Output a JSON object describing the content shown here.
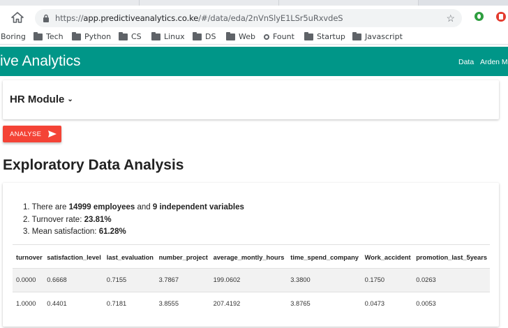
{
  "browser": {
    "url_host": "app.predictiveanalytics.co.ke",
    "url_path": "/#/data/eda/2nVnSlyE1LSr5uRxvdeS",
    "bookmarks": [
      "Boring",
      "Tech",
      "Python",
      "CS",
      "Linux",
      "DS",
      "Web",
      "Fount",
      "Startup",
      "Javascript"
    ]
  },
  "app": {
    "brand": "ive Analytics",
    "nav_data": "Data",
    "nav_user": "Arden Mo"
  },
  "module": {
    "title": "HR Module"
  },
  "analyse_button": "ANALYSE",
  "eda": {
    "title": "Exploratory Data Analysis",
    "stats": [
      {
        "num": "1.",
        "pre": "There are ",
        "b1": "14999 employees",
        "mid": " and ",
        "b2": "9 independent variables"
      },
      {
        "num": "2.",
        "pre": "Turnover rate: ",
        "b1": "23.81%"
      },
      {
        "num": "3.",
        "pre": "Mean satisfaction: ",
        "b1": "61.28%"
      }
    ],
    "table": {
      "headers": [
        "turnover",
        "satisfaction_level",
        "last_evaluation",
        "number_project",
        "average_montly_hours",
        "time_spend_company",
        "Work_accident",
        "promotion_last_5years"
      ],
      "rows": [
        [
          "0.0000",
          "0.6668",
          "0.7155",
          "3.7867",
          "199.0602",
          "3.3800",
          "0.1750",
          "0.0263"
        ],
        [
          "1.0000",
          "0.4401",
          "0.7181",
          "3.8555",
          "207.4192",
          "3.8765",
          "0.0473",
          "0.0053"
        ]
      ]
    }
  },
  "colors": {
    "appbar": "#009688",
    "analyse": "#f44336"
  }
}
